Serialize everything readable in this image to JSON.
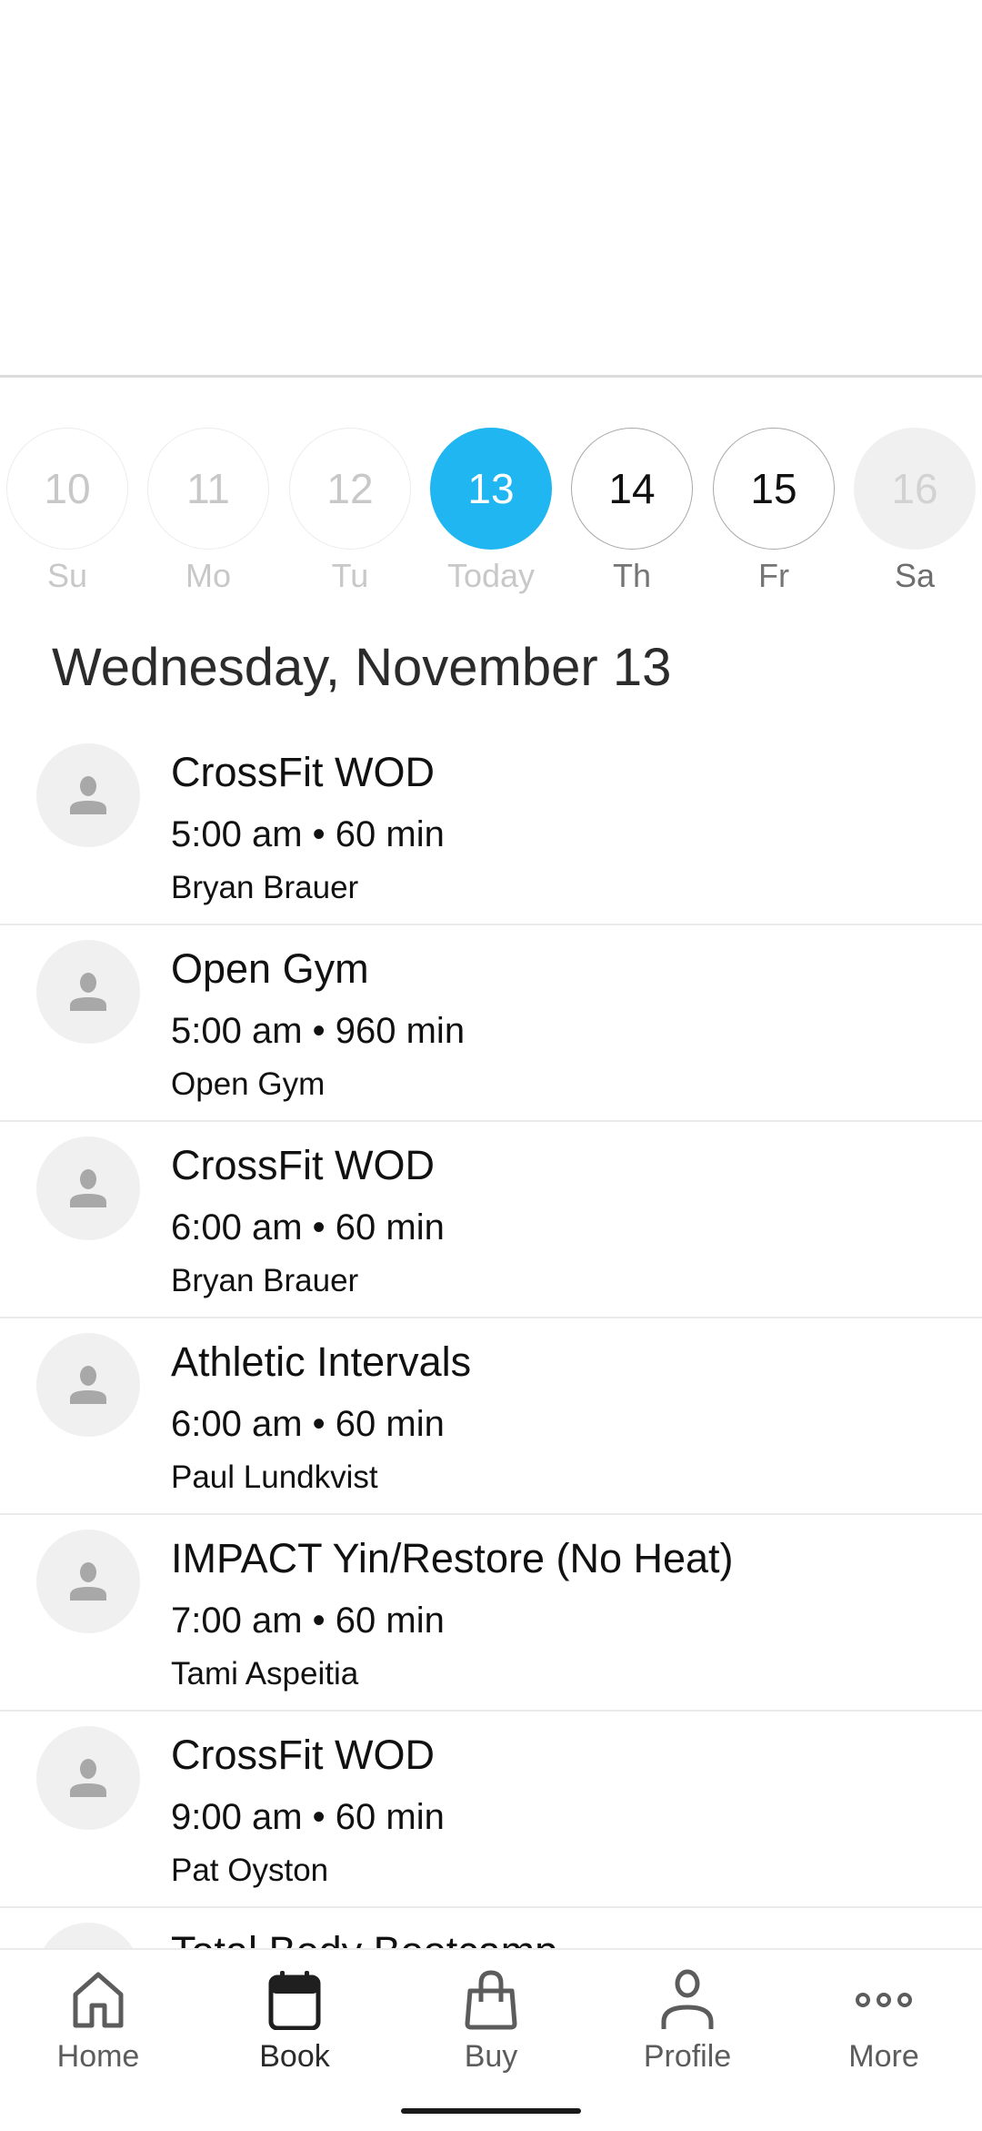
{
  "week": [
    {
      "num": "10",
      "label": "Su",
      "state": "past"
    },
    {
      "num": "11",
      "label": "Mo",
      "state": "past"
    },
    {
      "num": "12",
      "label": "Tu",
      "state": "past"
    },
    {
      "num": "13",
      "label": "Today",
      "state": "selected"
    },
    {
      "num": "14",
      "label": "Th",
      "state": "future"
    },
    {
      "num": "15",
      "label": "Fr",
      "state": "future"
    },
    {
      "num": "16",
      "label": "Sa",
      "state": "unavailable"
    }
  ],
  "date_title": "Wednesday, November 13",
  "classes": [
    {
      "title": "CrossFit WOD",
      "time": "5:00 am • 60 min",
      "instructor": "Bryan Brauer"
    },
    {
      "title": "Open Gym",
      "time": "5:00 am • 960 min",
      "instructor": "Open Gym"
    },
    {
      "title": "CrossFit WOD",
      "time": "6:00 am • 60 min",
      "instructor": "Bryan Brauer"
    },
    {
      "title": "Athletic Intervals",
      "time": "6:00 am • 60 min",
      "instructor": "Paul Lundkvist"
    },
    {
      "title": "IMPACT Yin/Restore (No Heat)",
      "time": "7:00 am • 60 min",
      "instructor": "Tami Aspeitia"
    },
    {
      "title": "CrossFit WOD",
      "time": "9:00 am • 60 min",
      "instructor": "Pat Oyston"
    },
    {
      "title": "Total Body Bootcamp",
      "time": "",
      "instructor": ""
    }
  ],
  "nav": [
    {
      "label": "Home",
      "icon": "home-icon"
    },
    {
      "label": "Book",
      "icon": "calendar-icon",
      "active": true
    },
    {
      "label": "Buy",
      "icon": "shopping-bag-icon"
    },
    {
      "label": "Profile",
      "icon": "person-icon"
    },
    {
      "label": "More",
      "icon": "more-dots-icon"
    }
  ],
  "colors": {
    "accent": "#1fb6f1"
  }
}
